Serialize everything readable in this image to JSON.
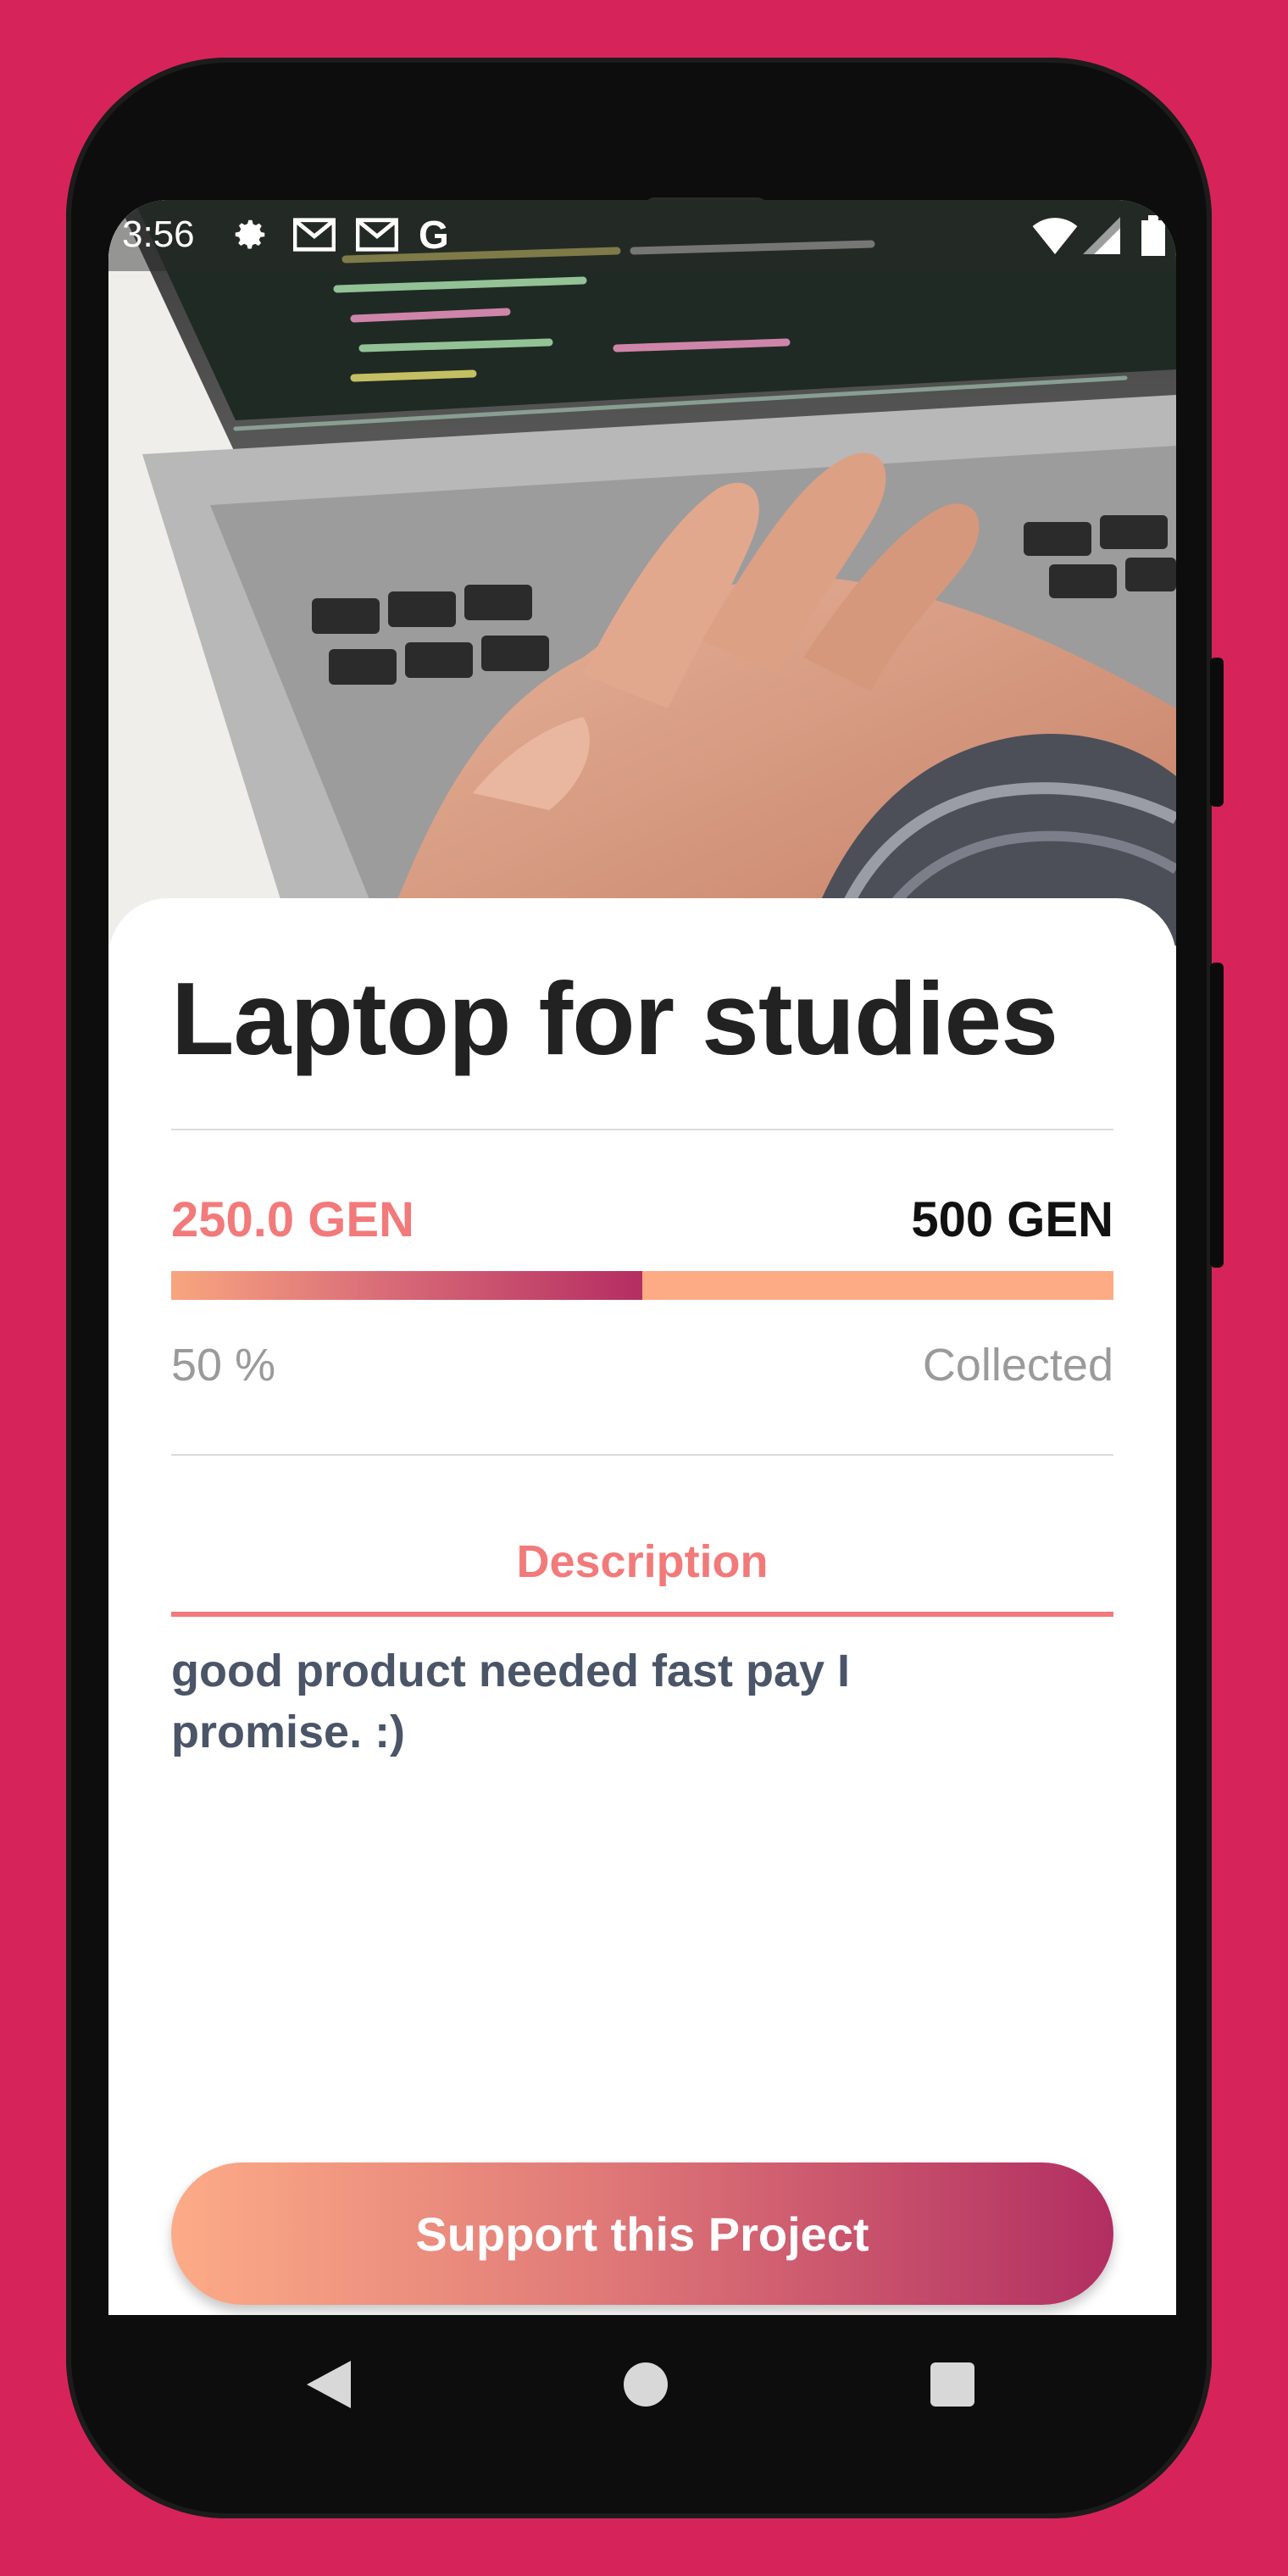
{
  "status_bar": {
    "time": "3:56",
    "left_icons": [
      "gear-icon",
      "gmail-icon",
      "gmail-icon",
      "google-icon"
    ],
    "right_icons": [
      "wifi-icon",
      "signal-icon",
      "battery-icon"
    ]
  },
  "project": {
    "title": "Laptop for studies",
    "collected_amount": "250.0 GEN",
    "goal_amount": "500 GEN",
    "progress_fraction": 0.5,
    "percent_label": "50 %",
    "collected_label": "Collected",
    "tab_label": "Description",
    "description": "good product needed fast pay I promise. :)",
    "support_button_label": "Support this Project"
  },
  "navigation": [
    "back-icon",
    "home-icon",
    "recents-icon"
  ],
  "colors": {
    "background": "#d6245a",
    "accent": "#f27a7a",
    "progress_track": "#fdab84",
    "gradient_start": "#fcab87",
    "gradient_end": "#b22e62",
    "text_dark": "#222222",
    "text_muted": "#9a9a9a",
    "description_text": "#4b5568"
  }
}
